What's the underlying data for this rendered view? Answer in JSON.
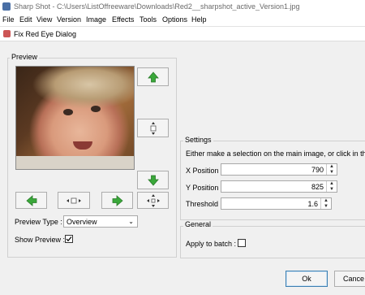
{
  "app": {
    "title": "Sharp Shot - C:\\Users\\ListOffreeware\\Downloads\\Red2__sharpshot_active_Version1.jpg"
  },
  "menu": [
    "File",
    "Edit",
    "View",
    "Version",
    "Image",
    "Effects",
    "Tools",
    "Options",
    "Help"
  ],
  "dialog": {
    "title": "Fix Red Eye Dialog"
  },
  "preview": {
    "group_label": "Preview",
    "type_label": "Preview Type :",
    "type_value": "Overview",
    "show_label": "Show Preview :",
    "show_checked": true
  },
  "settings": {
    "group_label": "Settings",
    "instruction": "Either make a selection on the main image, or click in the thu",
    "x_label": "X Position :",
    "x_value": "790",
    "y_label": "Y Position :",
    "y_value": "825",
    "threshold_label": "Threshold :",
    "threshold_value": "1.6"
  },
  "general": {
    "group_label": "General",
    "batch_label": "Apply to batch :",
    "batch_checked": false
  },
  "buttons": {
    "ok": "Ok",
    "cancel": "Cance"
  },
  "colors": {
    "arrow_green": "#3aa83a"
  }
}
